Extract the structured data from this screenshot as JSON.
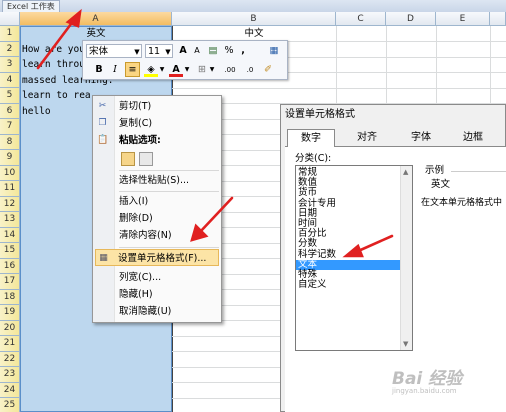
{
  "window": {
    "title": "Excel 工作表"
  },
  "columns": [
    "A",
    "B",
    "C",
    "D",
    "E"
  ],
  "rows": [
    "1",
    "2",
    "3",
    "4",
    "5",
    "6",
    "7",
    "8",
    "9",
    "10",
    "11",
    "12",
    "13",
    "14",
    "15",
    "16",
    "17",
    "18",
    "19",
    "20",
    "21",
    "22",
    "23",
    "24",
    "25"
  ],
  "cells": {
    "a1": "英文",
    "b1": "中文",
    "a2": "How are you",
    "a3": "learn throug",
    "a4": "massed learning.",
    "a5": "learn to rea",
    "a6": "hello"
  },
  "mini_toolbar": {
    "font_name": "宋体",
    "font_size": "11",
    "grow_font": "A",
    "shrink_font": "A",
    "percent": "%",
    "comma": ",",
    "bold": "B",
    "italic": "I",
    "increase_decimal": ".00",
    "decrease_decimal": ".0"
  },
  "context_menu": {
    "items": [
      {
        "label": "剪切(T)",
        "icon": "scissors-icon"
      },
      {
        "label": "复制(C)",
        "icon": "copy-icon"
      },
      {
        "label": "粘贴选项:",
        "icon": "clipboard-icon"
      },
      {
        "label": "选择性粘贴(S)...",
        "icon": ""
      },
      {
        "label": "插入(I)",
        "icon": ""
      },
      {
        "label": "删除(D)",
        "icon": ""
      },
      {
        "label": "清除内容(N)",
        "icon": ""
      },
      {
        "label": "设置单元格格式(F)...",
        "icon": "format-cells-icon"
      },
      {
        "label": "列宽(C)...",
        "icon": ""
      },
      {
        "label": "隐藏(H)",
        "icon": ""
      },
      {
        "label": "取消隐藏(U)",
        "icon": ""
      }
    ]
  },
  "dialog": {
    "title": "设置单元格格式",
    "tabs": [
      "数字",
      "对齐",
      "字体",
      "边框"
    ],
    "category_label": "分类(C):",
    "categories": [
      "常规",
      "数值",
      "货币",
      "会计专用",
      "日期",
      "时间",
      "百分比",
      "分数",
      "科学记数",
      "文本",
      "特殊",
      "自定义"
    ],
    "selected_category": "文本",
    "sample_label": "示例",
    "sample_value": "英文",
    "description": "在文本单元格格式中"
  },
  "watermark": {
    "text": "Bai 经验",
    "sub": "jingyan.baidu.com"
  },
  "colors": {
    "selection": "#bdd7ee",
    "menu_highlight": "#fce4a6",
    "list_highlight": "#3399ff",
    "arrow": "#e02020"
  }
}
